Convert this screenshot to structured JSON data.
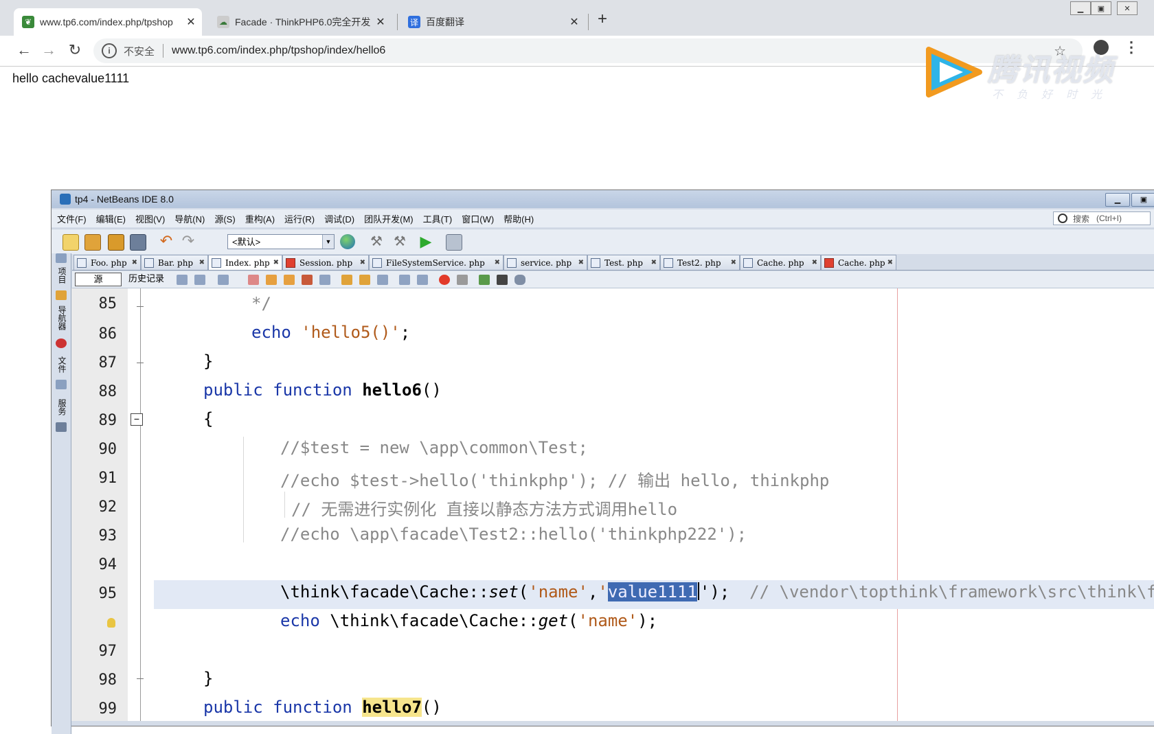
{
  "browser": {
    "tabs": [
      {
        "title": "www.tp6.com/index.php/tpshop",
        "close": "✕"
      },
      {
        "title": "Facade · ThinkPHP6.0完全开发",
        "close": "✕"
      },
      {
        "title": "百度翻译",
        "close": "✕"
      }
    ],
    "new_tab": "+",
    "security_label": "不安全",
    "url": "www.tp6.com/index.php/tpshop/index/hello6",
    "page_output": "hello cachevalue1111"
  },
  "watermark": {
    "title": "腾讯视频",
    "slogan": "不负好时光"
  },
  "ide": {
    "window_title": "tp4 - NetBeans IDE 8.0",
    "menus": [
      "文件(F)",
      "编辑(E)",
      "视图(V)",
      "导航(N)",
      "源(S)",
      "重构(A)",
      "运行(R)",
      "调试(D)",
      "团队开发(M)",
      "工具(T)",
      "窗口(W)",
      "帮助(H)"
    ],
    "search_label": "搜索",
    "search_hint": "(Ctrl+I)",
    "config_value": "<默认>",
    "side_panels": [
      "项目",
      "导航器",
      "文件",
      "服务"
    ],
    "file_tabs": [
      {
        "name": "Foo. php",
        "active": false,
        "error": false
      },
      {
        "name": "Bar. php",
        "active": false,
        "error": false
      },
      {
        "name": "Index. php",
        "active": true,
        "error": false
      },
      {
        "name": "Session. php",
        "active": false,
        "error": true
      },
      {
        "name": "FileSystemService. php",
        "active": false,
        "error": false
      },
      {
        "name": "service. php",
        "active": false,
        "error": false
      },
      {
        "name": "Test. php",
        "active": false,
        "error": false
      },
      {
        "name": "Test2. php",
        "active": false,
        "error": false
      },
      {
        "name": "Cache. php",
        "active": false,
        "error": false
      },
      {
        "name": "Cache. php",
        "active": false,
        "error": true
      }
    ],
    "editor_toolbar": {
      "source": "源",
      "history": "历史记录"
    },
    "line_numbers": [
      "85",
      "86",
      "87",
      "88",
      "89",
      "90",
      "91",
      "92",
      "93",
      "94",
      "95",
      "",
      "97",
      "98",
      "99"
    ],
    "code": {
      "l85": "*/",
      "l86_kw": "echo",
      "l86_str": "'hello5()'",
      "l86_end": ";",
      "l87": "}",
      "l88_kw": "public function",
      "l88_name": "hello6",
      "l88_end": "()",
      "l89": "{",
      "l90": "//$test = new \\app\\common\\Test;",
      "l91": "//echo $test->hello('thinkphp'); // 输出 hello, thinkphp",
      "l92": "// 无需进行实例化 直接以静态方法方式调用hello",
      "l93": "//echo \\app\\facade\\Test2::hello('thinkphp222');",
      "l95_a": "\\think\\facade\\Cache::",
      "l95_m": "set",
      "l95_b": "(",
      "l95_s1": "'name'",
      "l95_c": ",",
      "l95_q": "'",
      "l95_sel": "value1111",
      "l95_end": "');",
      "l95_cm": "// \\vendor\\topthink\\framework\\src\\think\\faca",
      "l96_kw": "echo",
      "l96_a": "\\think\\facade\\Cache::",
      "l96_m": "get",
      "l96_b": "(",
      "l96_s": "'name'",
      "l96_end": ");",
      "l98": "}",
      "l99_kw": "public function",
      "l99_name": "hello7",
      "l99_end": "()"
    }
  }
}
